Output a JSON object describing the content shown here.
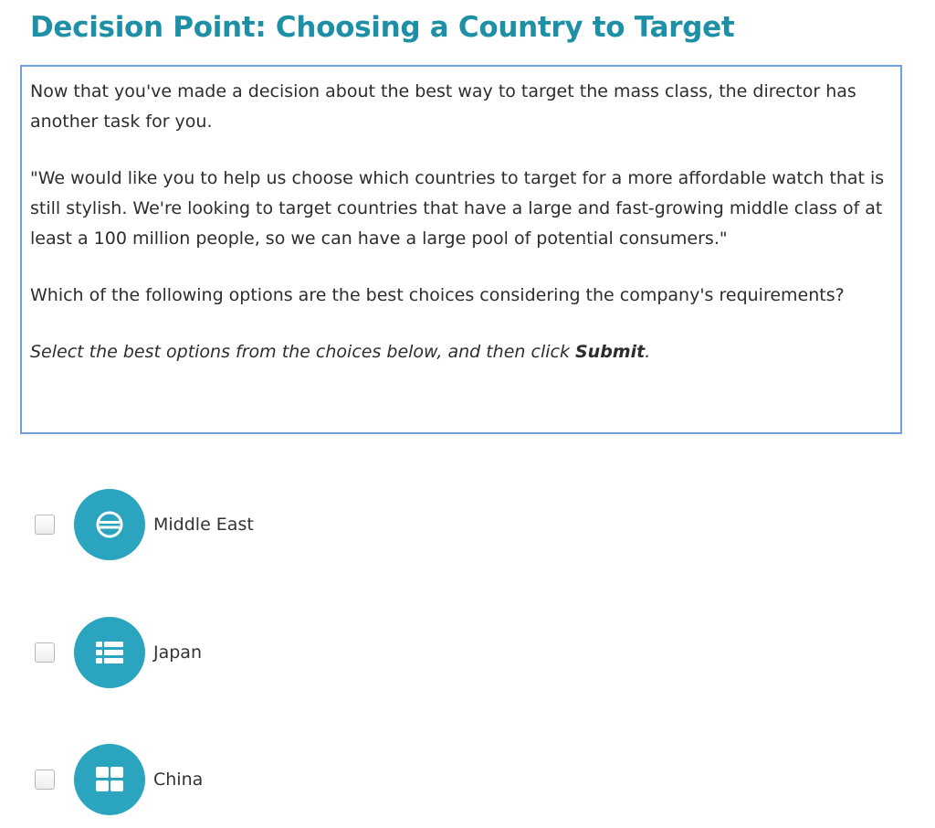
{
  "page": {
    "title": "Decision Point: Choosing a Country to Target"
  },
  "prompt": {
    "paragraph1": "Now that you've made a decision about the best way to target the mass class, the director has another task for you.",
    "paragraph2": "\"We would like you to help us choose which countries to target for a more affordable watch that is still stylish. We're looking to target countries that have a large and fast-growing middle class of at least a 100 million people, so we can have a large pool of potential consumers.\"",
    "paragraph3": "Which of the following options are the best choices considering the company's requirements?",
    "instruction_prefix": "Select the best options from the choices below, and then click ",
    "instruction_bold": "Submit",
    "instruction_suffix": "."
  },
  "options": [
    {
      "label": "Middle East",
      "checked": false,
      "icon": "no-entry-sign-icon"
    },
    {
      "label": "Japan",
      "checked": false,
      "icon": "list-icon"
    },
    {
      "label": "China",
      "checked": false,
      "icon": "grid-icon"
    }
  ],
  "colors": {
    "title": "#1d8fa6",
    "box_border": "#6f9fdc",
    "icon_circle": "#2ba4bf",
    "icon_fg": "#ffffff"
  }
}
